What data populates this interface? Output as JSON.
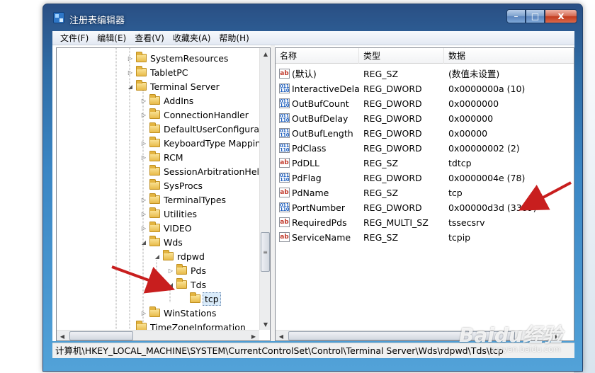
{
  "window": {
    "title": "注册表编辑器",
    "minimize": "–",
    "maximize": "□",
    "close": "x"
  },
  "menu": [
    {
      "label": "文件(F)"
    },
    {
      "label": "编辑(E)"
    },
    {
      "label": "查看(V)"
    },
    {
      "label": "收藏夹(A)"
    },
    {
      "label": "帮助(H)"
    }
  ],
  "tree": {
    "items": [
      {
        "label": "SystemResources",
        "expander": "▷"
      },
      {
        "label": "TabletPC",
        "expander": "▷"
      },
      {
        "label": "Terminal Server",
        "expander": "◢"
      },
      {
        "label": "AddIns",
        "expander": "▷"
      },
      {
        "label": "ConnectionHandler",
        "expander": "▷"
      },
      {
        "label": "DefaultUserConfigurat",
        "expander": ""
      },
      {
        "label": "KeyboardType Mappin",
        "expander": "▷"
      },
      {
        "label": "RCM",
        "expander": "▷"
      },
      {
        "label": "SessionArbitrationHelp",
        "expander": ""
      },
      {
        "label": "SysProcs",
        "expander": ""
      },
      {
        "label": "TerminalTypes",
        "expander": "▷"
      },
      {
        "label": "Utilities",
        "expander": "▷"
      },
      {
        "label": "VIDEO",
        "expander": "▷"
      },
      {
        "label": "Wds",
        "expander": "◢"
      },
      {
        "label": "rdpwd",
        "expander": "◢"
      },
      {
        "label": "Pds",
        "expander": "▷"
      },
      {
        "label": "Tds",
        "expander": "◢"
      },
      {
        "label": "tcp",
        "expander": ""
      },
      {
        "label": "WinStations",
        "expander": "▷"
      },
      {
        "label": "TimeZoneInformation",
        "expander": ""
      }
    ]
  },
  "list": {
    "columns": [
      "名称",
      "类型",
      "数据"
    ],
    "rows": [
      {
        "icon": "ab",
        "name": "(默认)",
        "type": "REG_SZ",
        "data": "(数值未设置)"
      },
      {
        "icon": "bin",
        "name": "InteractiveDelay",
        "type": "REG_DWORD",
        "data": "0x0000000a (10)"
      },
      {
        "icon": "bin",
        "name": "OutBufCount",
        "type": "REG_DWORD",
        "data": "0x0000000"
      },
      {
        "icon": "bin",
        "name": "OutBufDelay",
        "type": "REG_DWORD",
        "data": "0x000000"
      },
      {
        "icon": "bin",
        "name": "OutBufLength",
        "type": "REG_DWORD",
        "data": "0x00000"
      },
      {
        "icon": "bin",
        "name": "PdClass",
        "type": "REG_DWORD",
        "data": "0x00000002 (2)"
      },
      {
        "icon": "ab",
        "name": "PdDLL",
        "type": "REG_SZ",
        "data": "tdtcp"
      },
      {
        "icon": "bin",
        "name": "PdFlag",
        "type": "REG_DWORD",
        "data": "0x0000004e (78)"
      },
      {
        "icon": "ab",
        "name": "PdName",
        "type": "REG_SZ",
        "data": "tcp"
      },
      {
        "icon": "bin",
        "name": "PortNumber",
        "type": "REG_DWORD",
        "data": "0x00000d3d (3389)"
      },
      {
        "icon": "ab",
        "name": "RequiredPds",
        "type": "REG_MULTI_SZ",
        "data": "tssecsrv"
      },
      {
        "icon": "ab",
        "name": "ServiceName",
        "type": "REG_SZ",
        "data": "tcpip"
      }
    ]
  },
  "status": {
    "path": "计算机\\HKEY_LOCAL_MACHINE\\SYSTEM\\CurrentControlSet\\Control\\Terminal Server\\Wds\\rdpwd\\Tds\\tcp"
  },
  "watermark": {
    "text": "Baidu经验",
    "sub": "jingyan.baidu.com"
  },
  "colors": {
    "accent": "#3b86c4",
    "arrow": "#c81e1e",
    "selection": "#d9ebfa"
  }
}
